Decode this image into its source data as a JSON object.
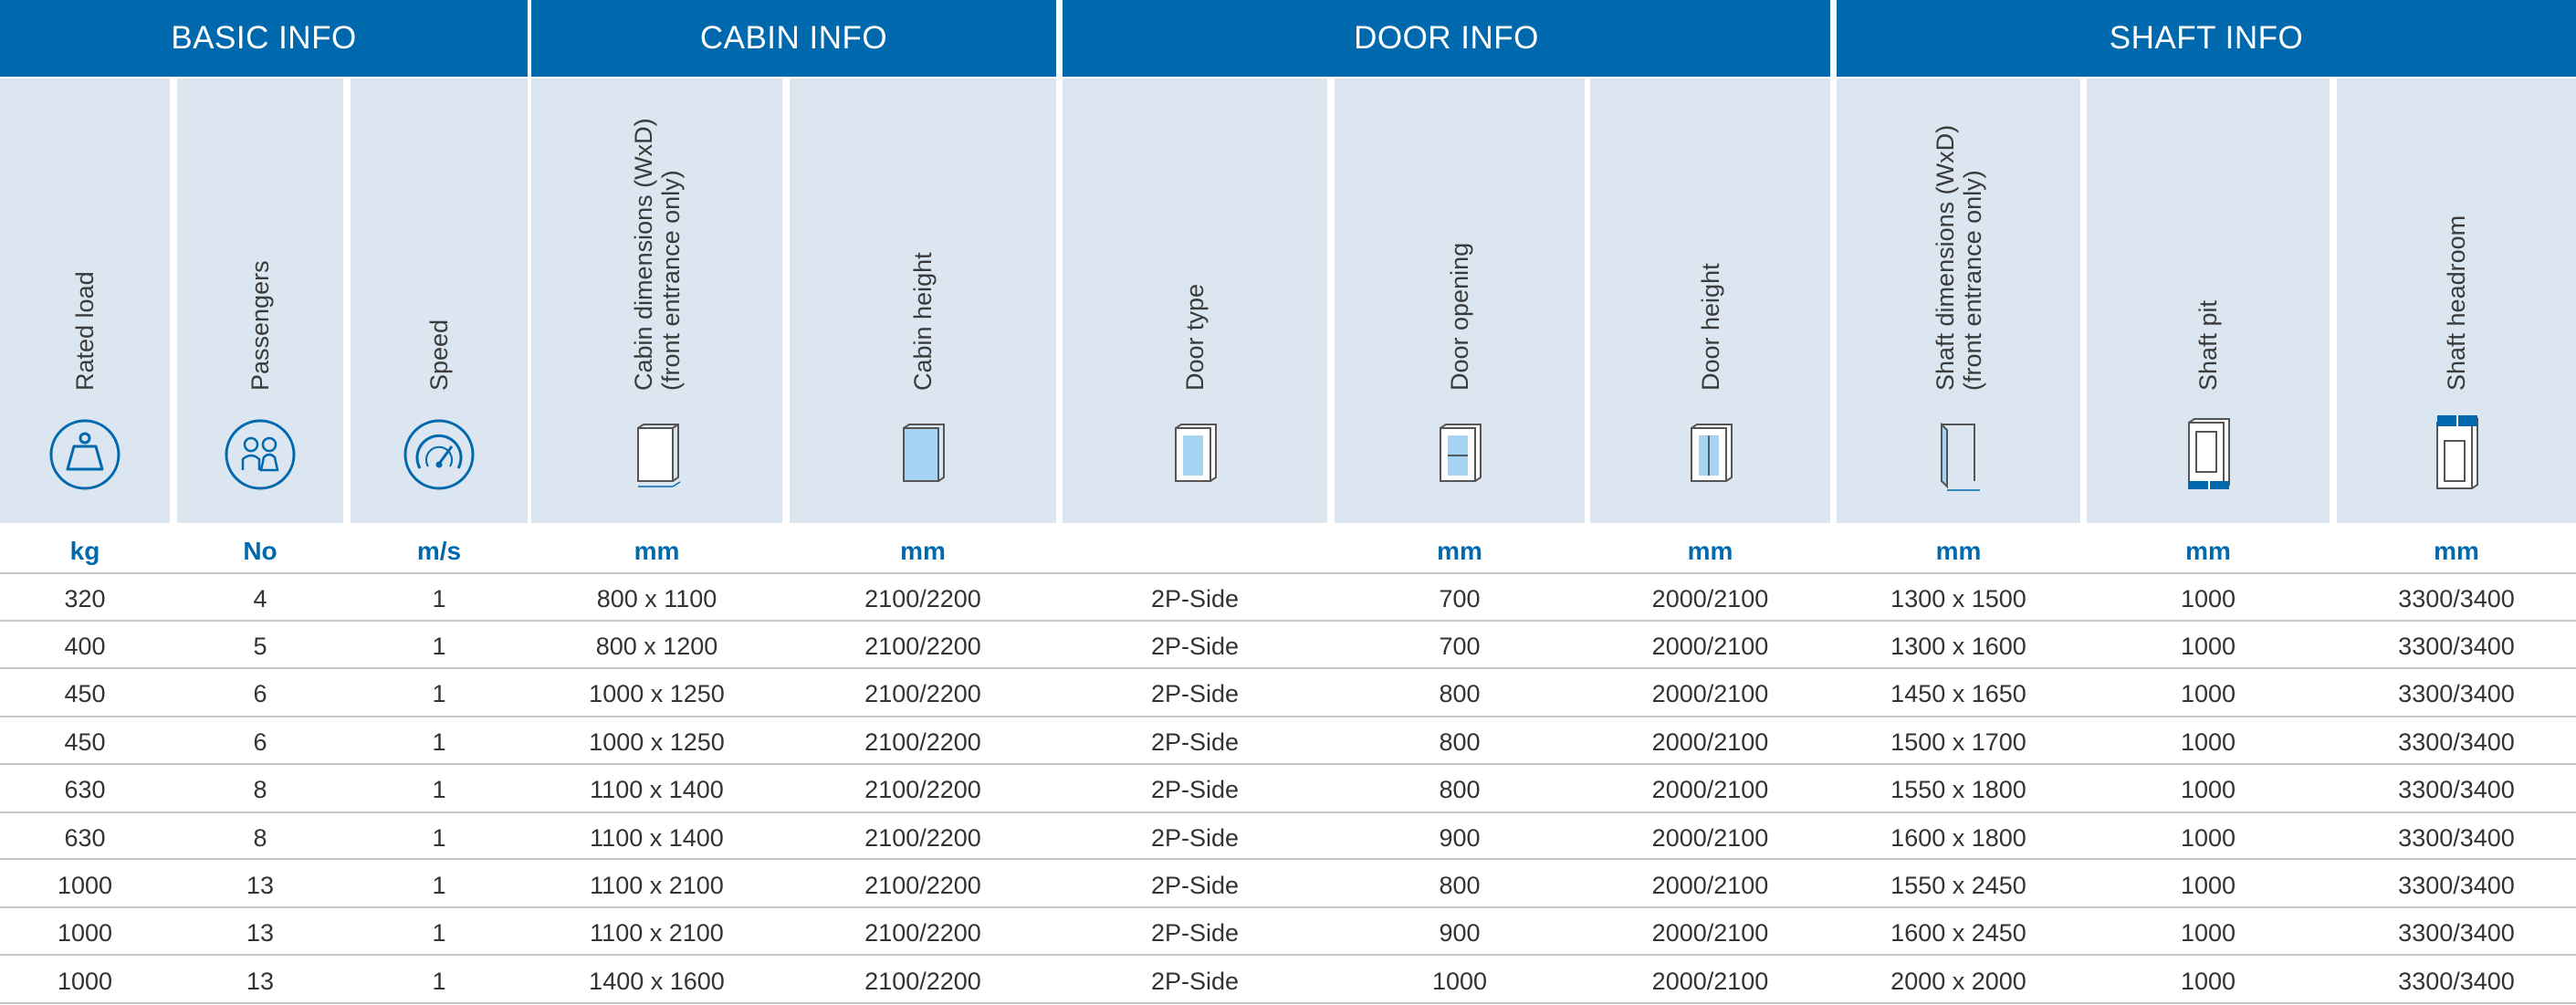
{
  "groups": {
    "basic": "BASIC INFO",
    "cabin": "CABIN INFO",
    "door": "DOOR INFO",
    "shaft": "SHAFT INFO"
  },
  "columns": [
    {
      "label": "Rated load",
      "unit": "kg",
      "icon": "weight-icon"
    },
    {
      "label": "Passengers",
      "unit": "No",
      "icon": "passengers-icon"
    },
    {
      "label": "Speed",
      "unit": "m/s",
      "icon": "speedometer-icon"
    },
    {
      "label": "Cabin dimensions (WxD)\n(front entrance only)",
      "unit": "mm",
      "icon": "cabin-dimensions-icon"
    },
    {
      "label": "Cabin height",
      "unit": "mm",
      "icon": "cabin-height-icon"
    },
    {
      "label": "Door type",
      "unit": "",
      "icon": "door-type-icon"
    },
    {
      "label": "Door opening",
      "unit": "mm",
      "icon": "door-opening-icon"
    },
    {
      "label": "Door height",
      "unit": "mm",
      "icon": "door-height-icon"
    },
    {
      "label": "Shaft dimensions (WxD)\n(front entrance only)",
      "unit": "mm",
      "icon": "shaft-dimensions-icon"
    },
    {
      "label": "Shaft pit",
      "unit": "mm",
      "icon": "shaft-pit-icon"
    },
    {
      "label": "Shaft headroom",
      "unit": "mm",
      "icon": "shaft-headroom-icon"
    }
  ],
  "rows": [
    [
      "320",
      "4",
      "1",
      "800 x 1100",
      "2100/2200",
      "2P-Side",
      "700",
      "2000/2100",
      "1300 x 1500",
      "1000",
      "3300/3400"
    ],
    [
      "400",
      "5",
      "1",
      "800 x 1200",
      "2100/2200",
      "2P-Side",
      "700",
      "2000/2100",
      "1300 x 1600",
      "1000",
      "3300/3400"
    ],
    [
      "450",
      "6",
      "1",
      "1000 x 1250",
      "2100/2200",
      "2P-Side",
      "800",
      "2000/2100",
      "1450 x 1650",
      "1000",
      "3300/3400"
    ],
    [
      "450",
      "6",
      "1",
      "1000 x 1250",
      "2100/2200",
      "2P-Side",
      "800",
      "2000/2100",
      "1500 x 1700",
      "1000",
      "3300/3400"
    ],
    [
      "630",
      "8",
      "1",
      "1100 x 1400",
      "2100/2200",
      "2P-Side",
      "800",
      "2000/2100",
      "1550 x 1800",
      "1000",
      "3300/3400"
    ],
    [
      "630",
      "8",
      "1",
      "1100 x 1400",
      "2100/2200",
      "2P-Side",
      "900",
      "2000/2100",
      "1600 x 1800",
      "1000",
      "3300/3400"
    ],
    [
      "1000",
      "13",
      "1",
      "1100 x 2100",
      "2100/2200",
      "2P-Side",
      "800",
      "2000/2100",
      "1550 x 2450",
      "1000",
      "3300/3400"
    ],
    [
      "1000",
      "13",
      "1",
      "1100 x 2100",
      "2100/2200",
      "2P-Side",
      "900",
      "2000/2100",
      "1600 x 2450",
      "1000",
      "3300/3400"
    ],
    [
      "1000",
      "13",
      "1",
      "1400 x 1600",
      "2100/2200",
      "2P-Side",
      "1000",
      "2000/2100",
      "2000 x 2000",
      "1000",
      "3300/3400"
    ]
  ],
  "colors": {
    "header_blue": "#0068ad",
    "header_light": "#dce6f1",
    "icon_fill": "#a7d3f3"
  }
}
